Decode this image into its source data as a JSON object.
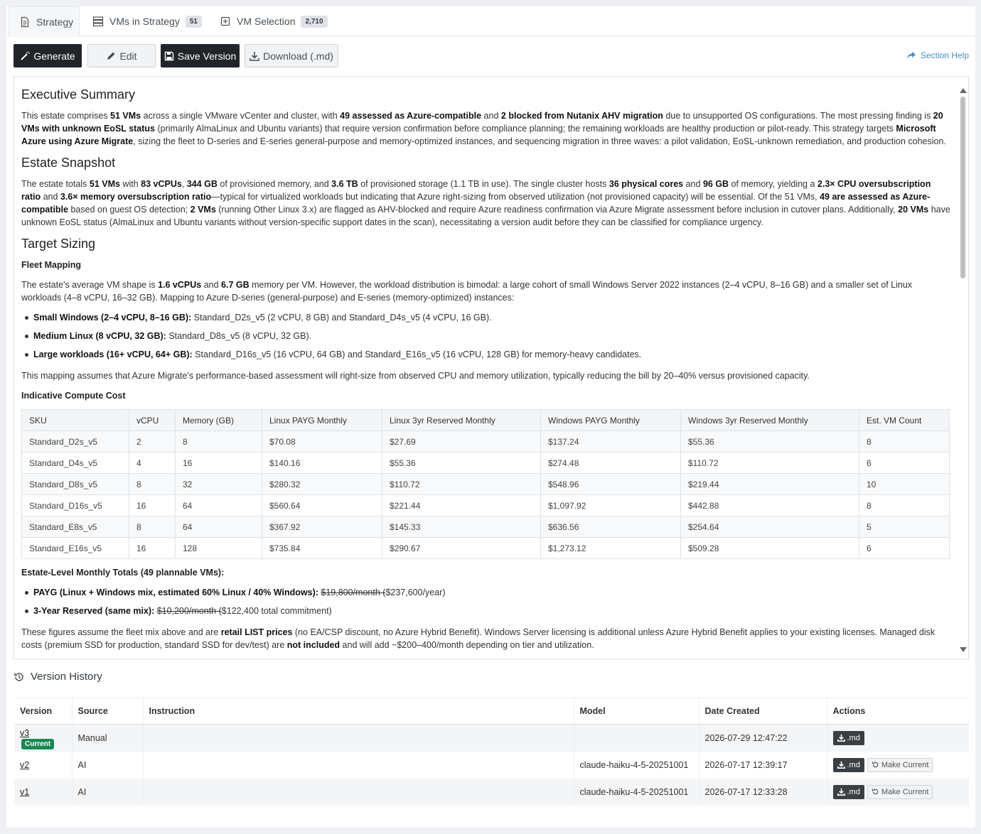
{
  "tabs": [
    {
      "label": "Strategy"
    },
    {
      "label": "VMs in Strategy",
      "badge": "51"
    },
    {
      "label": "VM Selection",
      "badge": "2,710"
    }
  ],
  "toolbar": {
    "generate": "Generate",
    "edit": "Edit",
    "save": "Save Version",
    "download": "Download (.md)",
    "help": "Section Help"
  },
  "doc": {
    "exec_title": "Executive Summary",
    "exec_p": [
      "This estate comprises ",
      "51 VMs",
      " across a single VMware vCenter and cluster, with ",
      "49 assessed as Azure-compatible",
      " and ",
      "2 blocked from Nutanix AHV migration",
      " due to unsupported OS configurations. The most pressing finding is ",
      "20 VMs with unknown EoSL status",
      " (primarily AlmaLinux and Ubuntu variants) that require version confirmation before compliance planning; the remaining workloads are healthy production or pilot-ready. This strategy targets ",
      "Microsoft Azure using Azure Migrate",
      ", sizing the fleet to D-series and E-series general-purpose and memory-optimized instances, and sequencing migration in three waves: a pilot validation, EoSL-unknown remediation, and production cohesion."
    ],
    "snap_title": "Estate Snapshot",
    "snap_p": [
      "The estate totals ",
      "51 VMs",
      " with ",
      "83 vCPUs",
      ", ",
      "344 GB",
      " of provisioned memory, and ",
      "3.6 TB",
      " of provisioned storage (1.1 TB in use). The single cluster hosts ",
      "36 physical cores",
      " and ",
      "96 GB",
      " of memory, yielding a ",
      "2.3× CPU oversubscription ratio",
      " and ",
      "3.6× memory oversubscription ratio",
      "—typical for virtualized workloads but indicating that Azure right-sizing from observed utilization (not provisioned capacity) will be essential. Of the 51 VMs, ",
      "49 are assessed as Azure-compatible",
      " based on guest OS detection; ",
      "2 VMs",
      " (running Other Linux 3.x) are flagged as AHV-blocked and require Azure readiness confirmation via Azure Migrate assessment before inclusion in cutover plans. Additionally, ",
      "20 VMs",
      " have unknown EoSL status (AlmaLinux and Ubuntu variants without version-specific support dates in the scan), necessitating a version audit before they can be classified for compliance urgency."
    ],
    "sizing_title": "Target Sizing",
    "fleet_title": "Fleet Mapping",
    "fleet_p": [
      "The estate's average VM shape is ",
      "1.6 vCPUs",
      " and ",
      "6.7 GB",
      " memory per VM. However, the workload distribution is bimodal: a large cohort of small Windows Server 2022 instances (2–4 vCPU, 8–16 GB) and a smaller set of Linux workloads (4–8 vCPU, 16–32 GB). Mapping to Azure D-series (general-purpose) and E-series (memory-optimized) instances:"
    ],
    "fleet_items": [
      {
        "b": "Small Windows (2–4 vCPU, 8–16 GB):",
        "t": " Standard_D2s_v5 (2 vCPU, 8 GB) and Standard_D4s_v5 (4 vCPU, 16 GB)."
      },
      {
        "b": "Medium Linux (8 vCPU, 32 GB):",
        "t": " Standard_D8s_v5 (8 vCPU, 32 GB)."
      },
      {
        "b": "Large workloads (16+ vCPU, 64+ GB):",
        "t": " Standard_D16s_v5 (16 vCPU, 64 GB) and Standard_E16s_v5 (16 vCPU, 128 GB) for memory-heavy candidates."
      }
    ],
    "mapping_note": "This mapping assumes that Azure Migrate's performance-based assessment will right-size from observed CPU and memory utilization, typically reducing the bill by 20–40% versus provisioned capacity.",
    "cost_title": "Indicative Compute Cost",
    "cost_headers": [
      "SKU",
      "vCPU",
      "Memory (GB)",
      "Linux PAYG Monthly",
      "Linux 3yr Reserved Monthly",
      "Windows PAYG Monthly",
      "Windows 3yr Reserved Monthly",
      "Est. VM Count"
    ],
    "cost_rows": [
      [
        "Standard_D2s_v5",
        "2",
        "8",
        "$70.08",
        "$27.69",
        "$137.24",
        "$55.36",
        "8"
      ],
      [
        "Standard_D4s_v5",
        "4",
        "16",
        "$140.16",
        "$55.36",
        "$274.48",
        "$110.72",
        "6"
      ],
      [
        "Standard_D8s_v5",
        "8",
        "32",
        "$280.32",
        "$110.72",
        "$548.96",
        "$219.44",
        "10"
      ],
      [
        "Standard_D16s_v5",
        "16",
        "64",
        "$560.64",
        "$221.44",
        "$1,097.92",
        "$442.88",
        "8"
      ],
      [
        "Standard_E8s_v5",
        "8",
        "64",
        "$367.92",
        "$145.33",
        "$636.56",
        "$254.64",
        "5"
      ],
      [
        "Standard_E16s_v5",
        "16",
        "128",
        "$735.84",
        "$290.67",
        "$1,273.12",
        "$509.28",
        "6"
      ]
    ],
    "totals_title": "Estate-Level Monthly Totals (49 plannable VMs):",
    "totals": [
      {
        "b": "PAYG (Linux + Windows mix, estimated 60% Linux / 40% Windows):",
        "s": "$19,800/month (",
        "t": "$237,600/year)"
      },
      {
        "b": "3-Year Reserved (same mix):",
        "s": "$10,200/month (",
        "t": "$122,400 total commitment)"
      }
    ],
    "final_p": [
      "These figures assume the fleet mix above and are ",
      "retail LIST prices",
      " (no EA/CSP discount, no Azure Hybrid Benefit). Windows Server licensing is additional unless Azure Hybrid Benefit applies to your existing licenses. Managed disk costs (premium SSD for production, standard SSD for dev/test) are ",
      "not included",
      " and will add ~$200–400/month depending on tier and utilization."
    ]
  },
  "history": {
    "title": "Version History",
    "headers": [
      "Version",
      "Source",
      "Instruction",
      "Model",
      "Date Created",
      "Actions"
    ],
    "current_label": "Current",
    "md_label": ".md",
    "make_current_label": "Make Current",
    "rows": [
      {
        "version": "v3",
        "current": true,
        "source": "Manual",
        "instruction": "",
        "model": "",
        "date": "2026-07-29 12:47:22"
      },
      {
        "version": "v2",
        "current": false,
        "source": "AI",
        "instruction": "",
        "model": "claude-haiku-4-5-20251001",
        "date": "2026-07-17 12:39:17"
      },
      {
        "version": "v1",
        "current": false,
        "source": "AI",
        "instruction": "",
        "model": "claude-haiku-4-5-20251001",
        "date": "2026-07-17 12:33:28"
      }
    ]
  },
  "colors": {
    "accent": "#212529",
    "link": "#4a8ec2",
    "current_badge": "#198754"
  }
}
